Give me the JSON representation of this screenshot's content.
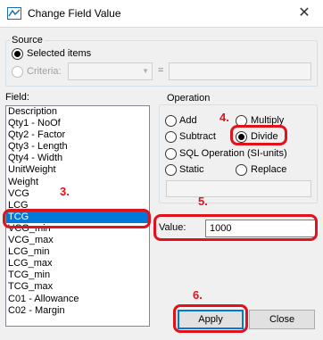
{
  "window": {
    "title": "Change Field Value",
    "close_glyph": "✕",
    "icon": "app-icon"
  },
  "source": {
    "group_label": "Source",
    "selected_items_label": "Selected items",
    "criteria_label": "Criteria:",
    "equals_sign": "="
  },
  "field": {
    "label": "Field:",
    "items": [
      "Description",
      "Qty1 - NoOf",
      "Qty2 - Factor",
      "Qty3 - Length",
      "Qty4 - Width",
      "UnitWeight",
      "Weight",
      "VCG",
      "LCG",
      "TCG",
      "VCG_min",
      "VCG_max",
      "LCG_min",
      "LCG_max",
      "TCG_min",
      "TCG_max",
      "C01 - Allowance",
      "C02 - Margin"
    ],
    "selected": "TCG"
  },
  "operation": {
    "group_label": "Operation",
    "add": "Add",
    "multiply": "Multiply",
    "subtract": "Subtract",
    "divide": "Divide",
    "sql": "SQL Operation (SI-units)",
    "static": "Static",
    "replace": "Replace",
    "selected": "Divide"
  },
  "value": {
    "label": "Value:",
    "text": "1000"
  },
  "buttons": {
    "apply": "Apply",
    "close": "Close"
  },
  "annotations": {
    "step3": "3.",
    "step4": "4.",
    "step5": "5.",
    "step6": "6.",
    "color": "#e0121b"
  }
}
